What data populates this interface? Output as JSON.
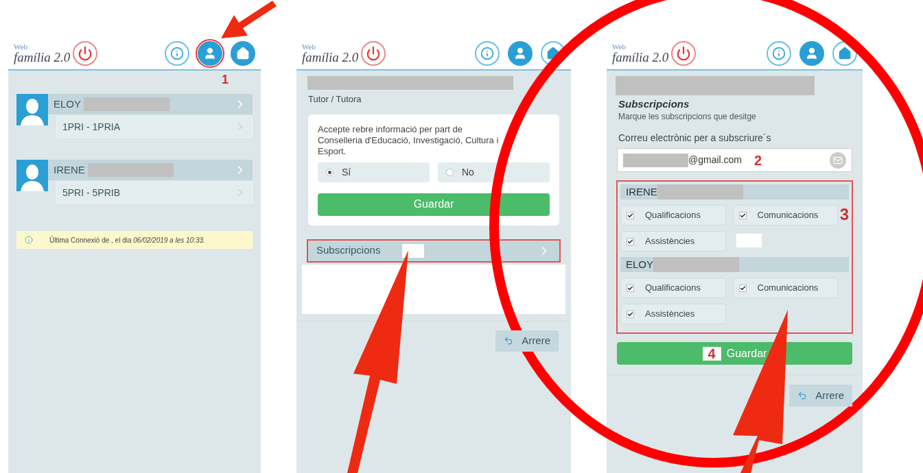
{
  "screens": [
    {
      "kind": "students",
      "logo_small": "Web",
      "logo": "família 2.0",
      "nav": [
        {
          "kind": "info",
          "selected": false,
          "circled": false
        },
        {
          "kind": "user",
          "selected": true,
          "circled": true
        },
        {
          "kind": "home",
          "selected": true,
          "circled": false
        }
      ],
      "step": "1",
      "students": [
        {
          "name": "ELOY",
          "group": "1PRI - 1PRIA"
        },
        {
          "name": "IRENE",
          "group": "5PRI - 5PRIB"
        }
      ],
      "notice": "Última Connexió de , el dia *06/02/2019 a les 10:33.*"
    },
    {
      "kind": "profile",
      "logo_small": "Web",
      "logo": "família 2.0",
      "nav": [
        {
          "kind": "info",
          "selected": false,
          "circled": false
        },
        {
          "kind": "user",
          "selected": true,
          "circled": false
        },
        {
          "kind": "home",
          "selected": false,
          "circled": false
        }
      ],
      "subtitle": "Tutor / Tutora",
      "consent": "Accepte rebre informació per part de Conselleria d'Educació, Investigació, Cultura i Esport.",
      "options": [
        {
          "label": "Sí",
          "selected": true
        },
        {
          "label": "No",
          "selected": false
        }
      ],
      "save": "Guardar",
      "link": {
        "label": "Subscripcions",
        "highlighted": true
      },
      "back": "Arrere"
    },
    {
      "kind": "subscriptions",
      "logo_small": "Web",
      "logo": "família 2.0",
      "nav": [
        {
          "kind": "info",
          "selected": false,
          "circled": false
        },
        {
          "kind": "user",
          "selected": true,
          "circled": false
        },
        {
          "kind": "home",
          "selected": false,
          "circled": false
        }
      ],
      "title": "Subscripcions",
      "description": "Marque les subscripcions que desitge",
      "email_label": "Correu electrònic per a subscriure´s",
      "email_value": "@gmail.com",
      "email_step": "2",
      "groups_step": "3",
      "save_step": "4",
      "groups": [
        {
          "name": "IRENE",
          "options": [
            {
              "label": "Qualificacions",
              "checked": true
            },
            {
              "label": "Comunicacions",
              "checked": true
            },
            {
              "label": "Assistències",
              "checked": true
            }
          ]
        },
        {
          "name": "ELOY",
          "options": [
            {
              "label": "Qualificacions",
              "checked": true
            },
            {
              "label": "Comunicacions",
              "checked": true
            },
            {
              "label": "Assistències",
              "checked": true
            }
          ]
        }
      ],
      "save": "Guardar",
      "back": "Arrere"
    }
  ]
}
